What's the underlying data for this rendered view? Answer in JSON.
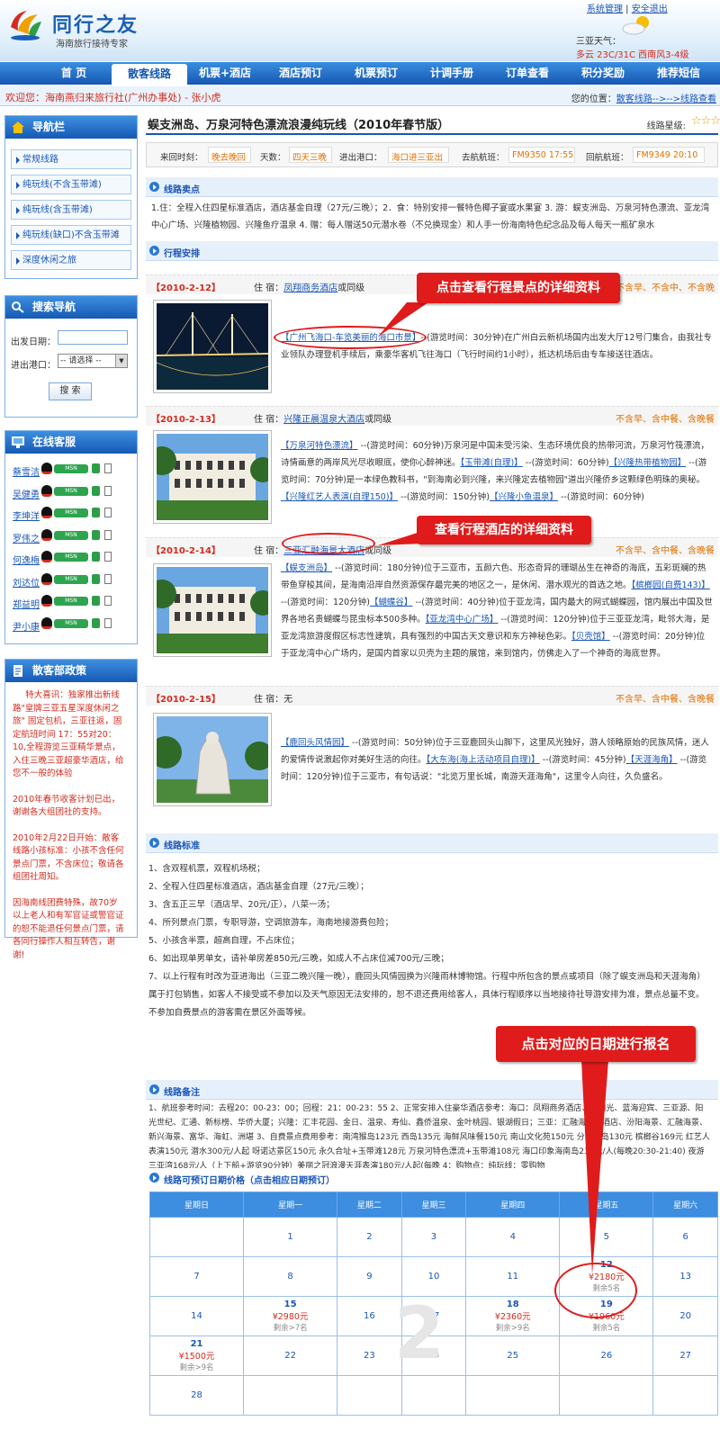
{
  "brand": {
    "title": "同行之友",
    "slogan": "海南旅行接待专家"
  },
  "toplinks": {
    "sys": "系统管理",
    "sep": " | ",
    "logout": "安全退出"
  },
  "weather": {
    "label": "三亚天气：",
    "value": "多云 23C/31C 西南风3-4级"
  },
  "nav": [
    "首 页",
    "散客线路",
    "机票+酒店",
    "酒店预订",
    "机票预订",
    "计调手册",
    "订单查看",
    "积分奖励",
    "推荐短信"
  ],
  "welcome": "欢迎您：海南燕归来旅行社(广州办事处) - 张小虎",
  "location": {
    "label": "您的位置：",
    "path": "散客线路-->-->线路查看"
  },
  "sidebar": {
    "nav_title": "导航栏",
    "categories": [
      "常规线路",
      "纯玩线(不含玉带滩)",
      "纯玩线(含玉带滩)",
      "纯玩线(缺口)不含玉带滩",
      "深度休闲之旅"
    ],
    "search_title": "搜索导航",
    "depart_label": "出发日期：",
    "port_label": "进出港口：",
    "port_value": "-- 请选择 --",
    "search_btn": "搜 索",
    "service_title": "在线客服",
    "service": [
      "蔡雪洁",
      "吴健勇",
      "李坤洋",
      "罗伟之",
      "何逸梅",
      "刘达位",
      "郑益明",
      "尹小康"
    ],
    "policy_title": "散客部政策",
    "policy": [
      "特大喜讯：独家推出新线路\"皇牌三亚五星深度休闲之旅\" 固定包机，三亚往返，固定航班时间 17：55对20：10,全程游览三亚精华景点，入住三晚三亚超豪华酒店，给您不一般的体验",
      "2010年春节收客计划已出，谢谢各大组团社的支持。",
      "2010年2月22日开始：散客线路小孩标准：小孩不含任何景点门票，不含床位；敬请各组团社周知。",
      "因海南线团费特殊，故70岁以上老人和有军官证或警官证的恕不能退任何景点门票，请各同行操作人相互转告，谢谢!"
    ]
  },
  "route": {
    "title": "蜈支洲岛、万泉河特色漂流浪漫纯玩线（2010年春节版）",
    "star_label": "线路星级:",
    "stars": "☆☆☆☆",
    "info": [
      {
        "k": "来回时刻：",
        "v": "晚去晚回"
      },
      {
        "k": "天数：",
        "v": "四天三晚"
      },
      {
        "k": "进出港口：",
        "v": "海口进三亚出"
      },
      {
        "k": "去航航班：",
        "v": "FM9350 17:55"
      },
      {
        "k": "回航航班：",
        "v": "FM9349 20:10"
      }
    ],
    "features_title": "线路卖点",
    "features": "1.住：全程入住四星标准酒店，酒店基金自理（27元/三晚）；2．食：特别安排一餐特色椰子宴或水果宴 3. 游：蜈支洲岛、万泉河特色漂流、亚龙湾中心广场、兴隆植物园、兴隆鱼疗温泉 4. 赠：每人赠送50元潜水卷（不兑换现金）和人手一份海南特色纪念品及每人每天一瓶矿泉水",
    "itinerary_title": "行程安排"
  },
  "days": [
    {
      "date": "【2010-2-12】",
      "stay_label": "住 宿：",
      "hotel": "凤翔商务酒店",
      "stay_suffix": "或同级",
      "meals": "不含早、不含中、不含晚",
      "text": [
        {
          "l": "【广州飞海口-车览美丽的海口市景】"
        },
        {
          "t": "--(游览时间：30分钟)在广州白云新机场国内出发大厅12号门集合，由我社专业领队办理登机手续后，乘豪华客机飞往海口（飞行时间约1小时），抵达机场后由专车接送往酒店。"
        }
      ]
    },
    {
      "date": "【2010-2-13】",
      "stay_label": "住 宿：",
      "hotel": "兴隆正晨温泉大酒店",
      "stay_suffix": "或同级",
      "meals": "不含早、含中餐、含晚餐",
      "text": [
        {
          "l": "【万泉河特色漂流】"
        },
        {
          "t": " --(游览时间：60分钟)万泉河是中国未受污染、生态环境优良的热带河流，万泉河竹筏漂流，诗情画意的两岸风光尽收眼底，使你心醉神迷。"
        },
        {
          "l": "【玉带滩(自理)】"
        },
        {
          "t": " --(游览时间：60分钟)"
        },
        {
          "l": "【兴隆热带植物园】"
        },
        {
          "t": " --(游览时间：70分钟)是一本绿色教科书，\"到海南必到兴隆，来兴隆定去植物园\"道出兴隆侨乡这颗绿色明珠的奥秘。"
        },
        {
          "l": "【兴隆红艺人表演(自理150)】"
        },
        {
          "t": " --(游览时间：150分钟)"
        },
        {
          "l": "【兴隆小鱼温泉】"
        },
        {
          "t": " --(游览时间：60分钟)"
        }
      ]
    },
    {
      "date": "【2010-2-14】",
      "stay_label": "住 宿：",
      "hotel": "三亚汇融海景大酒店",
      "stay_suffix": "或同级",
      "meals": "不含早、含中餐、含晚餐",
      "text": [
        {
          "l": "【蜈支洲岛】"
        },
        {
          "t": " --(游览时间：180分钟)位于三亚市，五颜六色、形态奇异的珊瑚丛生在神奇的海底，五彩斑斓的热带鱼穿梭其间，是海南沿岸自然资源保存最完美的地区之一，是休闲、潜水观光的首选之地。"
        },
        {
          "l": "【槟榔园(自费143)】"
        },
        {
          "t": " --(游览时间：120分钟)"
        },
        {
          "l": "【蝴蝶谷】"
        },
        {
          "t": " --(游览时间：40分钟)位于亚龙湾，国内最大的网式蝴蝶园，馆内展出中国及世界各地名贵蝴蝶与昆虫标本500多种。"
        },
        {
          "l": "【亚龙湾中心广场】"
        },
        {
          "t": " --(游览时间：120分钟)位于三亚亚龙湾，毗邻大海，是亚龙湾旅游度假区标志性建筑，具有强烈的中国古天文意识和东方神秘色彩。"
        },
        {
          "l": "【贝壳馆】"
        },
        {
          "t": " --(游览时间：20分钟)位于亚龙湾中心广场内，是国内首家以贝壳为主题的展馆，来到馆内，仿佛走入了一个神奇的海底世界。"
        }
      ]
    },
    {
      "date": "【2010-2-15】",
      "stay_label": "住 宿：",
      "hotel": "",
      "stay_suffix": "无",
      "meals": "不含早、含中餐、含晚餐",
      "text": [
        {
          "l": "【鹿回头风情园】"
        },
        {
          "t": " --(游览时间：50分钟)位于三亚鹿回头山脚下，这里风光独好，游人领略原始的民族风情，迷人的爱情传说激起你对美好生活的向往。"
        },
        {
          "l": "【大东海(海上活动项目自理)】"
        },
        {
          "t": " --(游览时间：45分钟)"
        },
        {
          "l": "【天涯海角】"
        },
        {
          "t": " --(游览时间：120分钟)位于三亚市，有句话说：\"北览万里长城，南游天涯海角\"，这里令人向往，久负盛名。"
        }
      ]
    }
  ],
  "standard_title": "线路标准",
  "standard": [
    "1、含双程机票，双程机场税；",
    "2、全程入住四星标准酒店，酒店基金自理（27元/三晚）；",
    "3、含五正三早（酒店早、20元/正），八菜一汤；",
    "4、所列景点门票，专职导游，空调旅游车，海南地接游费包险；",
    "5、小孩含半票，超高自理，不占床位；",
    "6、如出现单男单女，请补单房差850元/三晚，如成人不占床位减700元/三晚；",
    "7、以上行程有时改为亚进海出（三亚二晚兴隆一晚），鹿回头风情园换为兴隆雨林博物馆。行程中所包含的景点或项目（除了蜈支洲岛和天涯海角）属于打包销售，如客人不接受或不参加以及天气原因无法安排的，恕不退还费用给客人，具体行程顺序以当地接待社导游安排为准，景点总量不变。不参加自费景点的游客需在景区外面等候。"
  ],
  "notes_title": "线路备注",
  "notes": "1、航班参考时间：去程20：00-23：00；回程：21：00-23：55 2、正常安排入住豪华酒店参考：海口：凤翔商务酒店、海阳光、蓝海迎宾、三亚源、阳光世纪、汇通、新标榜、华侨大厦；兴隆：汇丰花园、金日、温泉、寿仙、鑫侨温泉、金叶桃园、银湖假日；三亚：汇融海景大酒店、汾阳海景、汇融海景、新兴海景、富华、海虹、洲堪 3、自费景点费用参考：南湾猴岛123元 西岛135元 海鲜风味餐150元 南山文化苑150元 分界洲岛130元 槟榔谷169元 红艺人表演150元 潜水300元/人起 呀诺达景区150元 永久合址+玉带滩128元 万泉河特色漂流+玉带滩108元 海口印象海南岛238元/人(每晚20:30-21:40) 夜游三亚湾168元/人（上下船+游览90分钟）美丽之冠浪漫天涯表演180元/人起(每晚 4：购物点：纯玩线：零购物",
  "calendar_title": "线路可预订日期价格（点击相应日期预订）",
  "calendar": {
    "weekdays": [
      "星期日",
      "星期一",
      "星期二",
      "星期三",
      "星期四",
      "星期五",
      "星期六"
    ],
    "month_watermark": "2",
    "weeks": [
      [
        null,
        {
          "d": "1"
        },
        {
          "d": "2"
        },
        {
          "d": "3"
        },
        {
          "d": "4"
        },
        {
          "d": "5"
        },
        {
          "d": "6"
        }
      ],
      [
        {
          "d": "7"
        },
        {
          "d": "8"
        },
        {
          "d": "9"
        },
        {
          "d": "10"
        },
        {
          "d": "11"
        },
        {
          "d": "12",
          "p": "¥2180元",
          "r": "剩余5名"
        },
        {
          "d": "13"
        }
      ],
      [
        {
          "d": "14"
        },
        {
          "d": "15",
          "p": "¥2980元",
          "r": "剩余>7名"
        },
        {
          "d": "16"
        },
        {
          "d": "17"
        },
        {
          "d": "18",
          "p": "¥2360元",
          "r": "剩余>9名"
        },
        {
          "d": "19",
          "p": "¥1960元",
          "r": "剩余5名"
        },
        {
          "d": "20"
        }
      ],
      [
        {
          "d": "21",
          "p": "¥1500元",
          "r": "剩余>9名"
        },
        {
          "d": "22"
        },
        {
          "d": "23"
        },
        {
          "d": "24"
        },
        {
          "d": "25"
        },
        {
          "d": "26"
        },
        {
          "d": "27"
        }
      ],
      [
        {
          "d": "28"
        },
        null,
        null,
        null,
        null,
        null,
        null
      ]
    ]
  },
  "callouts": {
    "spot": "点击查看行程景点的详细资料",
    "hotel": "查看行程酒店的详细资料",
    "date": "点击对应的日期进行报名"
  }
}
